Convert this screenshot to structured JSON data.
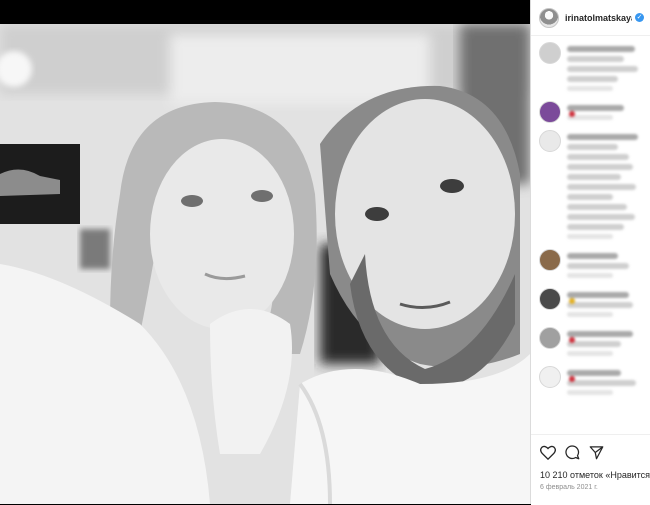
{
  "post": {
    "username": "irinatolmatskaya",
    "verified_mark": "✓"
  },
  "comments": [
    {
      "avatar_color": "#cfcfcf",
      "lines": 4,
      "reaction": ""
    },
    {
      "avatar_color": "#7b4a9a",
      "lines": 1,
      "reaction": "#d0303c"
    },
    {
      "avatar_color": "#e9e9e9",
      "lines": 10,
      "reaction": ""
    },
    {
      "avatar_color": "#8a6a4a",
      "lines": 2,
      "reaction": ""
    },
    {
      "avatar_color": "#4a4a4a",
      "lines": 2,
      "reaction": "#e3b022"
    },
    {
      "avatar_color": "#a0a0a0",
      "lines": 2,
      "reaction": "#d0303c"
    },
    {
      "avatar_color": "#f0f0f0",
      "lines": 2,
      "reaction": "#d0303c"
    }
  ],
  "actions": {
    "likes": "10 210 отметок «Нравится»",
    "date": "6 февраль 2021 г."
  },
  "icons": [
    "heart-icon",
    "comment-icon",
    "share-icon"
  ]
}
